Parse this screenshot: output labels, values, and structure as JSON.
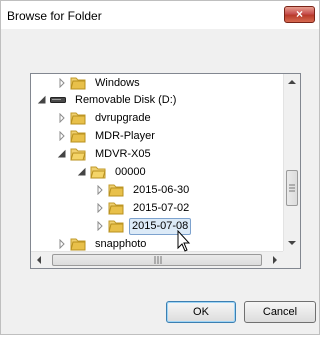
{
  "window": {
    "title": "Browse for Folder",
    "close_label": "×"
  },
  "tree": {
    "items": [
      {
        "label": "Windows",
        "type": "folder",
        "expander": "collapsed"
      },
      {
        "label": "Removable Disk (D:)",
        "type": "drive",
        "expander": "expanded"
      },
      {
        "label": "dvrupgrade",
        "type": "folder",
        "expander": "collapsed"
      },
      {
        "label": "MDR-Player",
        "type": "folder",
        "expander": "collapsed"
      },
      {
        "label": "MDVR-X05",
        "type": "folder",
        "expander": "expanded"
      },
      {
        "label": "00000",
        "type": "folder",
        "expander": "expanded"
      },
      {
        "label": "2015-06-30",
        "type": "folder",
        "expander": "collapsed"
      },
      {
        "label": "2015-07-02",
        "type": "folder",
        "expander": "collapsed"
      },
      {
        "label": "2015-07-08",
        "type": "folder",
        "expander": "collapsed",
        "selected": true
      },
      {
        "label": "snapphoto",
        "type": "folder",
        "expander": "collapsed"
      }
    ]
  },
  "buttons": {
    "ok": "OK",
    "cancel": "Cancel"
  },
  "colors": {
    "folder": "#e8c04a",
    "selection_bg": "#dceaf7",
    "selection_border": "#7da2ce"
  }
}
